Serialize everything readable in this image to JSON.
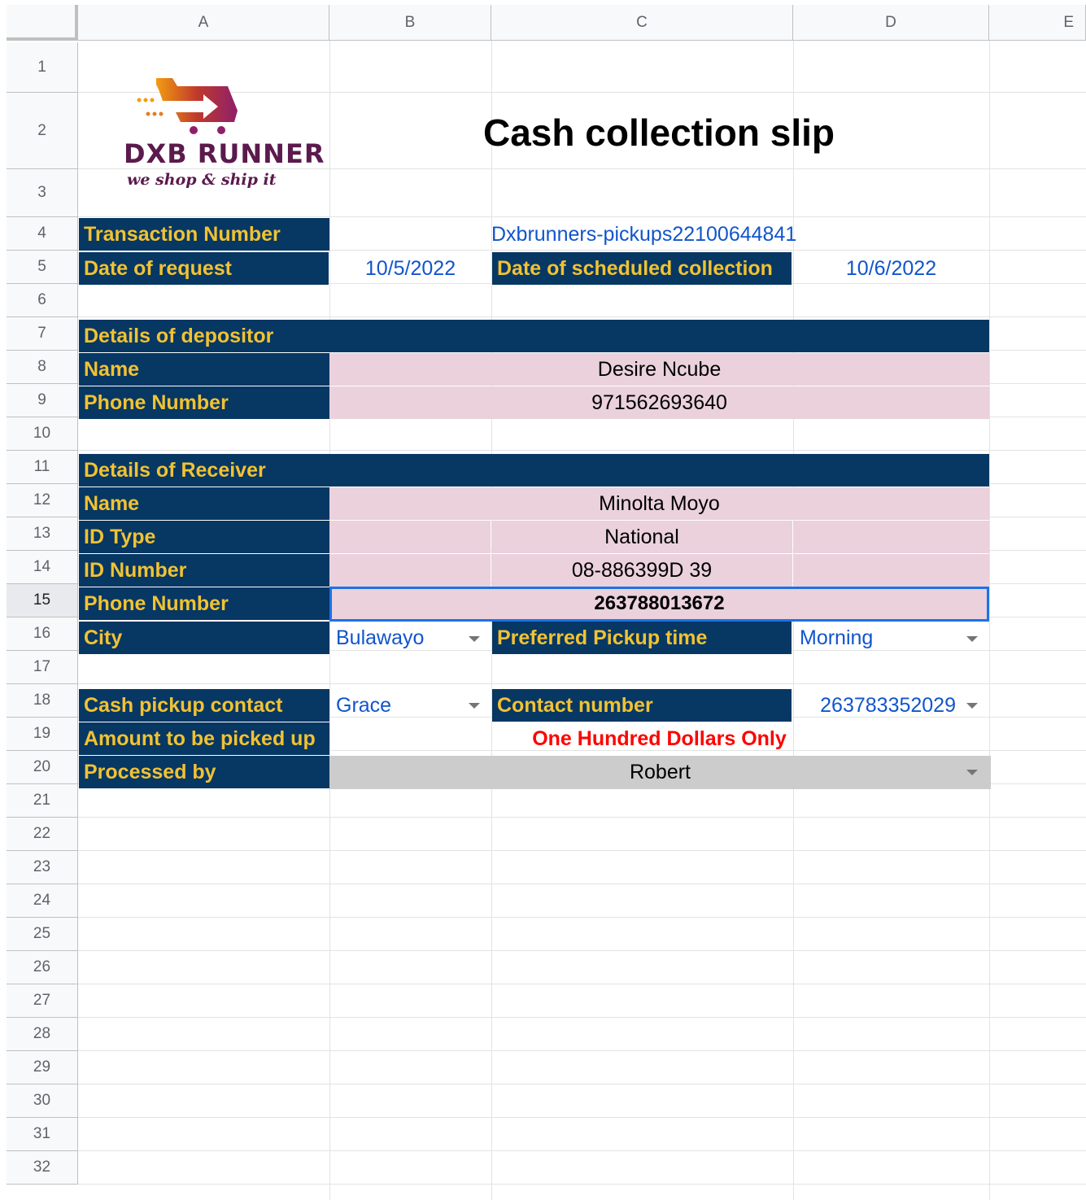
{
  "columns": [
    "A",
    "B",
    "C",
    "D",
    "E"
  ],
  "rows": [
    "1",
    "2",
    "3",
    "4",
    "5",
    "6",
    "7",
    "8",
    "9",
    "10",
    "11",
    "12",
    "13",
    "14",
    "15",
    "16",
    "17",
    "18",
    "19",
    "20",
    "21",
    "22",
    "23",
    "24",
    "25",
    "26",
    "27",
    "28",
    "29",
    "30",
    "31",
    "32"
  ],
  "logo": {
    "name": "DXB RUNNER",
    "tagline": "we shop & ship it",
    "colors": [
      "#f39c12",
      "#c0392b",
      "#8e1f6b"
    ]
  },
  "title": "Cash collection slip",
  "transaction": {
    "label": "Transaction Number",
    "value": "Dxbrunners-pickups22100644841"
  },
  "request": {
    "label": "Date of request",
    "value": "10/5/2022"
  },
  "scheduled": {
    "label": "Date of scheduled collection",
    "value": "10/6/2022"
  },
  "depositor": {
    "heading": "Details of depositor",
    "name_label": "Name",
    "name": "Desire Ncube",
    "phone_label": "Phone Number",
    "phone": "971562693640"
  },
  "receiver": {
    "heading": "Details of Receiver",
    "name_label": "Name",
    "name": "Minolta Moyo",
    "id_type_label": "ID Type",
    "id_type": "National",
    "id_number_label": "ID Number",
    "id_number": "08-886399D 39",
    "phone_label": "Phone Number",
    "phone": "263788013672"
  },
  "city": {
    "label": "City",
    "value": "Bulawayo"
  },
  "pickup_time": {
    "label": "Preferred Pickup time",
    "value": "Morning"
  },
  "cash_contact": {
    "label": "Cash pickup contact",
    "value": "Grace"
  },
  "contact_number": {
    "label": "Contact number",
    "value": "263783352029"
  },
  "amount": {
    "label": "Amount to be picked up",
    "value": "One Hundred Dollars Only"
  },
  "processed": {
    "label": "Processed by",
    "value": "Robert"
  },
  "colors": {
    "header_fill": "#073763",
    "header_text": "#f1c232",
    "value_fill": "#ead1dc",
    "link_text": "#1155cc",
    "amount_text": "#ff0000",
    "selection": "#1a73e8"
  }
}
